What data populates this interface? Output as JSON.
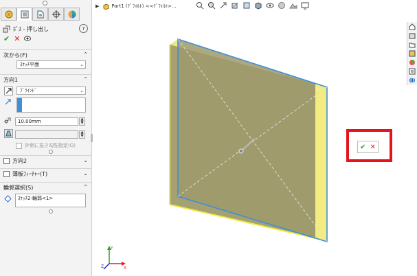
{
  "panel": {
    "tabs": [
      "feature-manager-icon",
      "property-manager-icon",
      "configuration-manager-icon",
      "dimxpert-icon",
      "display-manager-icon"
    ],
    "title": "ﾎﾞｽ - 押し出し",
    "help": "?",
    "ok_glyph": "✔",
    "cancel_glyph": "✕",
    "from": {
      "label": "次から(F)",
      "value": "ｽｹｯﾁ平面"
    },
    "direction1": {
      "label": "方向1",
      "end_condition": "ﾌﾞﾗｲﾝﾄﾞ",
      "depth": "10.00mm",
      "draft_outward": "外側に抜き勾配指定(O)"
    },
    "direction2": {
      "label": "方向2"
    },
    "thin_feature": {
      "label": "薄板ﾌｨｰﾁｬｰ(T)"
    },
    "contours": {
      "label": "輪郭選択(S)",
      "value": "ｽｹｯﾁ2-輪郭<1>"
    }
  },
  "viewport": {
    "breadcrumb": "Part1  (ﾃﾞﾌｫﾙﾄ) <<ﾃﾞﾌｫﾙﾄ>...",
    "confirm_ok": "✔",
    "confirm_cancel": "✕",
    "triad": {
      "x": "X",
      "y": "Y",
      "z": "Z"
    }
  },
  "colors": {
    "accent": "#3d8fd9",
    "highlight_yellow": "#f2ea74",
    "confirm_border": "#e3141b"
  }
}
